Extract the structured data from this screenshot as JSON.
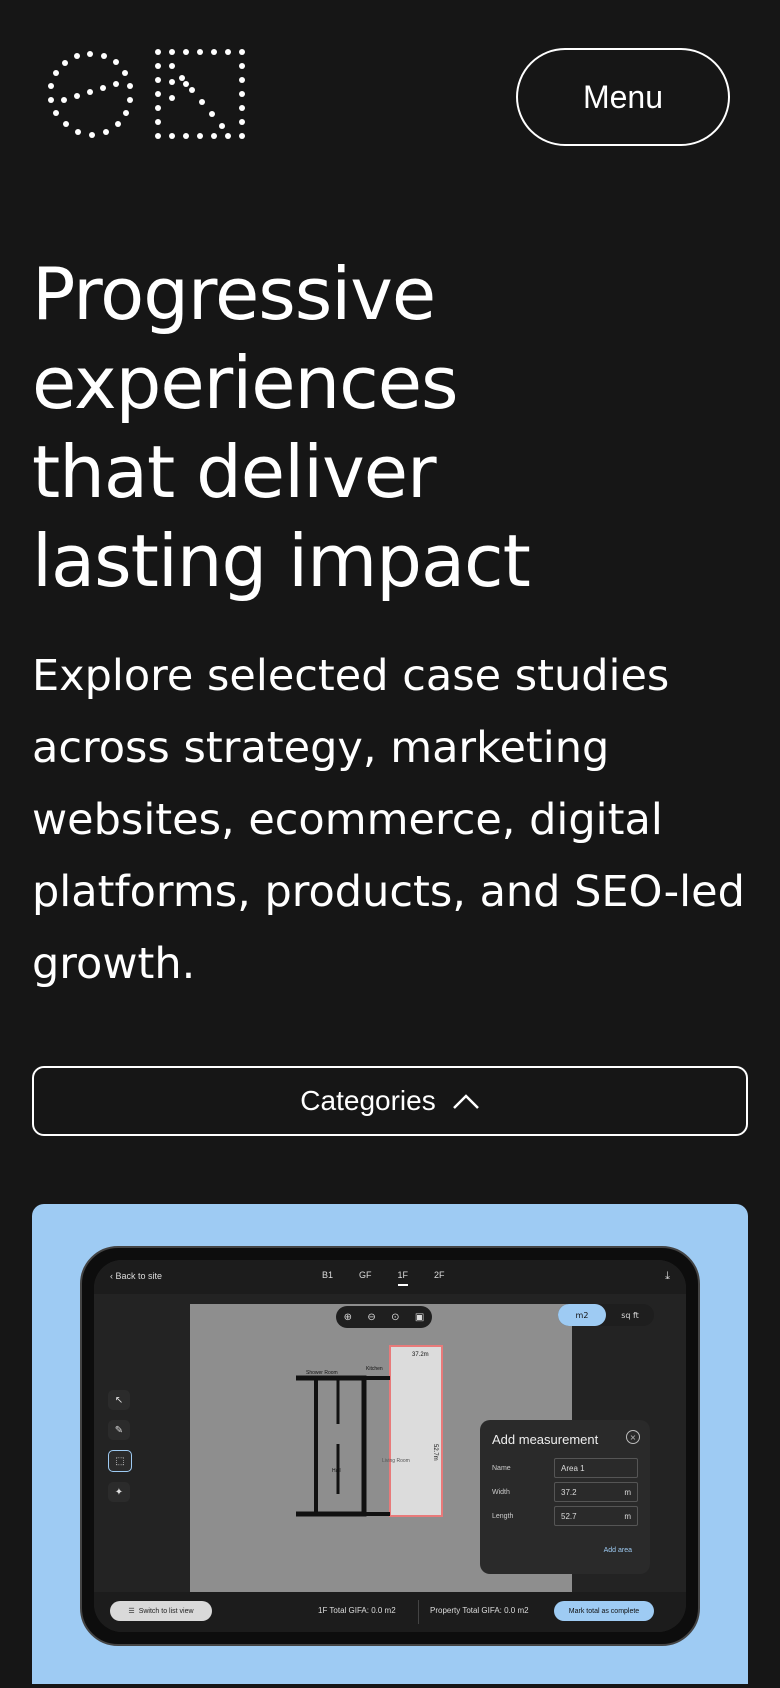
{
  "header": {
    "menu_label": "Menu",
    "logo_icon": "dotted-logo-icon"
  },
  "hero": {
    "title_lines": [
      "Progressive",
      "experiences",
      "that deliver",
      "lasting impact"
    ],
    "intro": "Explore selected case studies across strategy, marketing websites, ecommerce, digital platforms, products, and SEO-led growth."
  },
  "categories": {
    "label": "Categories",
    "icon": "chevron-up-icon"
  },
  "card": {
    "background_color": "#9ecbf3",
    "app": {
      "back_label": "Back to site",
      "floors": [
        "B1",
        "GF",
        "1F",
        "2F"
      ],
      "active_floor": "1F",
      "units": [
        "m2",
        "sq ft"
      ],
      "active_unit": "m2",
      "plan_labels": {
        "top_dimension": "37.2m",
        "side_dimension": "52.7m",
        "shower": "Shower Room",
        "kitchen": "Kitchen",
        "hall": "Hall",
        "living": "Living Room"
      },
      "panel": {
        "title": "Add measurement",
        "fields": [
          {
            "label": "Name",
            "value": "Area 1",
            "unit": ""
          },
          {
            "label": "Width",
            "value": "37.2",
            "unit": "m"
          },
          {
            "label": "Length",
            "value": "52.7",
            "unit": "m"
          }
        ],
        "add_label": "Add area"
      },
      "bottom": {
        "list_view_label": "Switch to list view",
        "floor_total": "1F Total GIFA: 0.0 m2",
        "property_total": "Property Total GIFA: 0.0 m2",
        "complete_label": "Mark total as complete"
      }
    }
  }
}
